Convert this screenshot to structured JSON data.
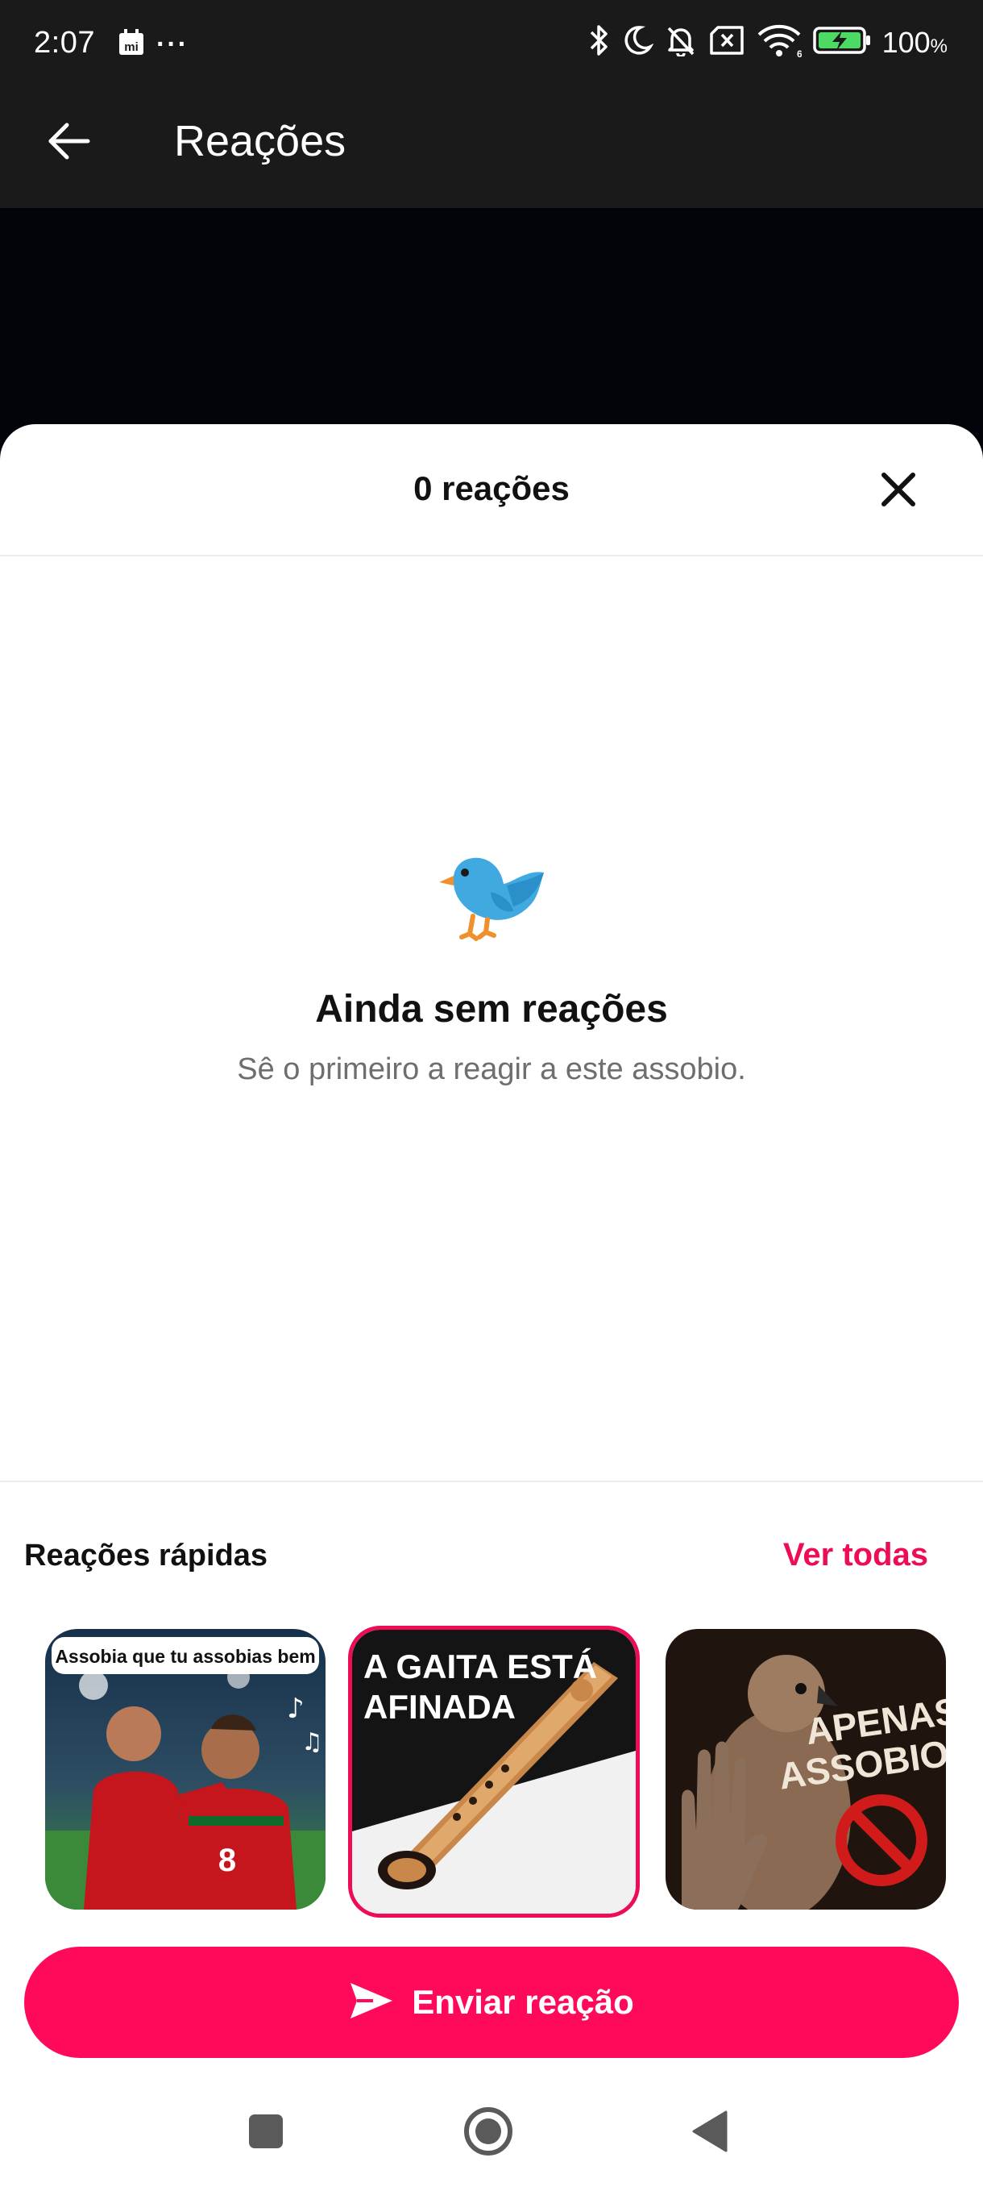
{
  "status_bar": {
    "time": "2:07",
    "more": "···",
    "battery": "100",
    "battery_unit": "%",
    "icons": [
      "mi-calendar-icon",
      "bluetooth-icon",
      "moon-icon",
      "bell-off-icon",
      "sim-off-icon",
      "wifi-icon",
      "battery-charging-icon"
    ]
  },
  "app_bar": {
    "title": "Reações",
    "back_icon": "arrow-left-icon"
  },
  "sheet": {
    "title": "0 reações",
    "close_icon": "close-icon"
  },
  "empty_state": {
    "icon": "bird-icon",
    "title": "Ainda sem reações",
    "subtitle": "Sê o primeiro a reagir a este assobio."
  },
  "quick_reactions": {
    "title": "Reações rápidas",
    "see_all": "Ver todas",
    "items": [
      {
        "caption": "Assobia que tu assobias bem",
        "selected": false
      },
      {
        "caption_line1": "A GAITA ESTÁ",
        "caption_line2": "AFINADA",
        "selected": true
      },
      {
        "caption_line1": "APENAS",
        "caption_line2": "ASSOBIOS",
        "selected": false
      }
    ]
  },
  "send_button": {
    "label": "Enviar reação",
    "icon": "send-icon"
  },
  "nav_bar": {
    "buttons": [
      "recents-square-icon",
      "home-circle-icon",
      "back-triangle-icon"
    ]
  },
  "colors": {
    "accent": "#ff0a5a",
    "link": "#ee0c55",
    "header_bg": "#1a1a1a",
    "scrim": "#02040a"
  }
}
